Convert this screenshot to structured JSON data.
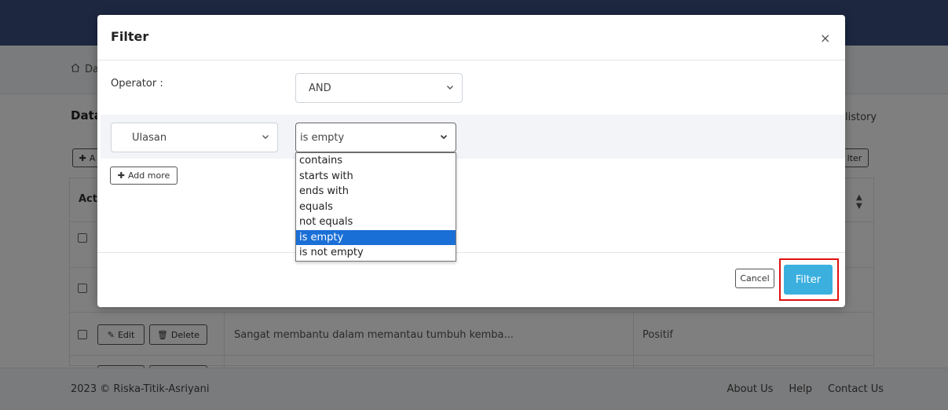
{
  "background": {
    "breadcrumb_label": "Da",
    "section_title": "Data",
    "history_link": "listory",
    "add_button_label": "A",
    "filter_button_label": "lter",
    "actions_header": "Act",
    "row": {
      "edit_label": "Edit",
      "delete_label": "Delete",
      "review_text": "Sangat membantu dalam memantau tumbuh kemba...",
      "sentiment": "Positif"
    }
  },
  "footer": {
    "copyright": "2023 © Riska-Titik-Asriyani",
    "links": [
      "About Us",
      "Help",
      "Contact Us"
    ]
  },
  "modal": {
    "title": "Filter",
    "close_symbol": "×",
    "operator_label": "Operator :",
    "operator_value": "AND",
    "field_value": "Ulasan",
    "condition_value": "is empty",
    "condition_options": [
      "contains",
      "starts with",
      "ends with",
      "equals",
      "not equals",
      "is empty",
      "is not empty"
    ],
    "selected_option_index": 5,
    "add_more_label": "Add more",
    "cancel_label": "Cancel",
    "filter_label": "Filter"
  },
  "colors": {
    "topbar": "#3a4f80",
    "primary_button": "#3bb0df",
    "highlight_border": "#e01010",
    "selected_option": "#1a6fd6"
  },
  "icons": {
    "breadcrumb": "home-icon",
    "close": "close-icon",
    "select": "chevron-down-icon",
    "add": "plus-icon",
    "edit": "pencil-icon",
    "delete": "trash-icon",
    "sort": "sort-icon"
  }
}
